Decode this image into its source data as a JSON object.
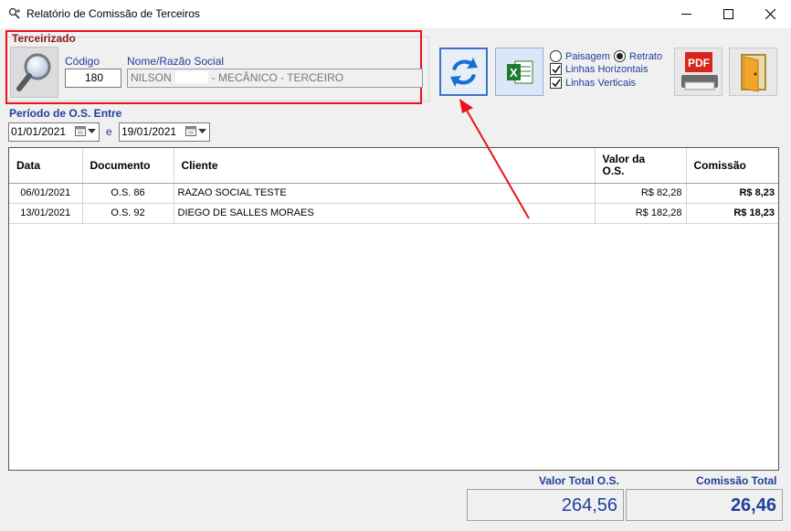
{
  "window": {
    "title": "Relatório de Comissão de Terceiros",
    "minimize_icon": "minimize-icon",
    "maximize_icon": "maximize-icon",
    "close_icon": "close-icon"
  },
  "terceirizado": {
    "group_label": "Terceirizado",
    "codigo_label": "Código",
    "codigo_value": "180",
    "nome_label": "Nome/Razão Social",
    "nome_part1": "NILSON",
    "nome_part2": "- MECÂNICO - TERCEIRO"
  },
  "options": {
    "paisagem": "Paisagem",
    "retrato": "Retrato",
    "orientation_selected": "Retrato",
    "linhas_horizontais": "Linhas Horizontais",
    "linhas_verticais": "Linhas Verticais",
    "linhas_horizontais_checked": true,
    "linhas_verticais_checked": true
  },
  "toolbar": {
    "pdf_label": "PDF"
  },
  "periodo": {
    "label": "Período de O.S. Entre",
    "start": "01/01/2021",
    "separator": "e",
    "end": "19/01/2021"
  },
  "table": {
    "headers": {
      "data": "Data",
      "documento": "Documento",
      "cliente": "Cliente",
      "valor_line1": "Valor da",
      "valor_line2": "O.S.",
      "comissao": "Comissão"
    },
    "rows": [
      {
        "data": "06/01/2021",
        "documento": "O.S. 86",
        "cliente": "RAZAO SOCIAL TESTE",
        "valor": "R$ 82,28",
        "comissao": "R$ 8,23"
      },
      {
        "data": "13/01/2021",
        "documento": "O.S. 92",
        "cliente": "DIEGO DE SALLES MORAES",
        "valor": "R$ 182,28",
        "comissao": "R$ 18,23"
      }
    ]
  },
  "totals": {
    "valor_label": "Valor Total O.S.",
    "valor_value": "264,56",
    "comissao_label": "Comissão Total",
    "comissao_value": "26,46"
  },
  "colors": {
    "highlight_red": "#e8141d",
    "label_blue": "#1f3f99",
    "group_label": "#8b1a1a"
  }
}
